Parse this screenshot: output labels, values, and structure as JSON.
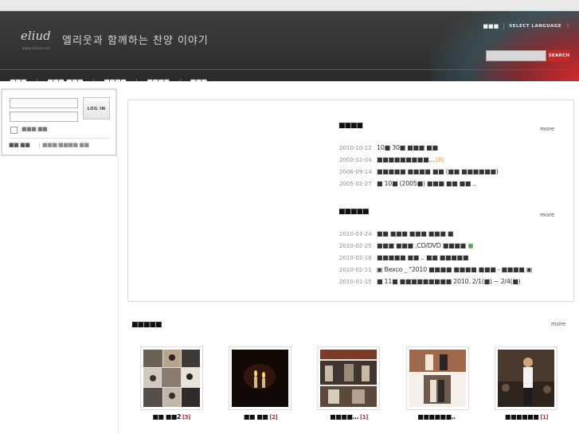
{
  "header": {
    "logo_mark": "eliud",
    "logo_sub": "www.eliud.net",
    "slogan": "엘리웃과 함께하는 찬양 이야기",
    "lang_squares": "■■■",
    "lang_label": "SELECT LANGUAGE",
    "search_placeholder": "",
    "search_button": "SEARCH"
  },
  "nav": {
    "items": [
      "■■■",
      "■■■,■■■",
      "■■■■",
      "■■■■",
      "■■■"
    ]
  },
  "login": {
    "id_value": "",
    "pw_value": "",
    "button": "LOG IN",
    "remember_label": "■■■ ■■",
    "link_join": "■■ ■■",
    "link_find": "■■■/■■■■ ■■"
  },
  "notice": {
    "title": "■■■■",
    "more": "more",
    "items": [
      {
        "date": "2010-10-12",
        "title": "10■ 30■ ■■■ ■■",
        "count": ""
      },
      {
        "date": "2003-12-04",
        "title": "■■■■■■■■■...",
        "count": "[3]"
      },
      {
        "date": "2006-09-14",
        "title": "■■■■■ ■■■■ ■■ (■■ ■■■■■■)",
        "count": ""
      },
      {
        "date": "2005-02-27",
        "title": "■ 10■ (2005■) ■■■ ■■ ■■ ..",
        "count": ""
      }
    ]
  },
  "board": {
    "title": "■■■■■",
    "more": "more",
    "items": [
      {
        "date": "2010-03-24",
        "title": "■■ ■■■ ■■■ ■■■ ■"
      },
      {
        "date": "2010-02-25",
        "title": "■■■ ■■■ ,CD/DVD ■■■■"
      },
      {
        "date": "2010-02-18",
        "title": "■■■■■ ■■ .. ■■ ■■■■■"
      },
      {
        "date": "2010-02-11",
        "title": "▣ Bexco _ \"2010 ■■■■ ■■■■ ■■■ - ■■■■ ▣"
      },
      {
        "date": "2010-01-15",
        "title": "■ 11■ ■■■■■■■■■ 2010. 2/1(■) ~ 2/4(■)"
      }
    ]
  },
  "gallery": {
    "title": "■■■■■",
    "more": "more",
    "items": [
      {
        "caption": "■■ ■■2",
        "count": "[3]"
      },
      {
        "caption": "■■ ■■",
        "count": "[2]"
      },
      {
        "caption": "■■■■...",
        "count": "[1]"
      },
      {
        "caption": "■■■■■■..",
        "count": ""
      },
      {
        "caption": "■■■■■■",
        "count": "[1]"
      }
    ]
  }
}
